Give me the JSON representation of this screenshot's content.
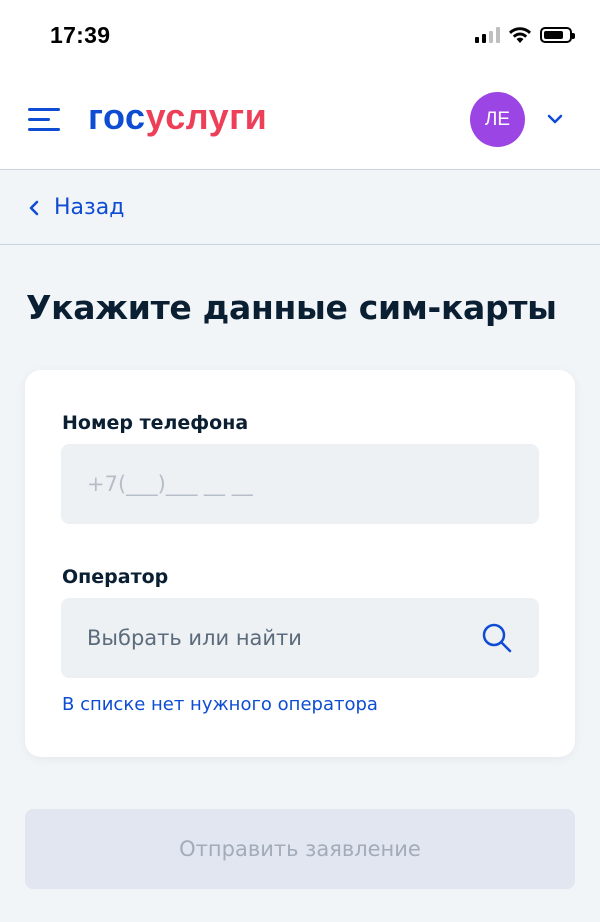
{
  "status_bar": {
    "time": "17:39"
  },
  "header": {
    "logo_part1": "гос",
    "logo_part2": "услуги",
    "avatar_initials": "ЛЕ",
    "colors": {
      "brand_blue": "#0d4cd3",
      "brand_red": "#ee3f58",
      "avatar_bg": "#9b45e5"
    }
  },
  "nav": {
    "back_label": "Назад"
  },
  "form": {
    "title": "Укажите данные сим-карты",
    "phone_label": "Номер телефона",
    "phone_placeholder": "+7(___)___ __ __",
    "operator_label": "Оператор",
    "operator_placeholder": "Выбрать или найти",
    "no_operator_link": "В списке нет нужного оператора",
    "submit_label": "Отправить заявление"
  },
  "icons": [
    "menu-icon",
    "chevron-down-icon",
    "chevron-left-icon",
    "search-icon",
    "signal-icon",
    "wifi-icon",
    "battery-icon"
  ]
}
